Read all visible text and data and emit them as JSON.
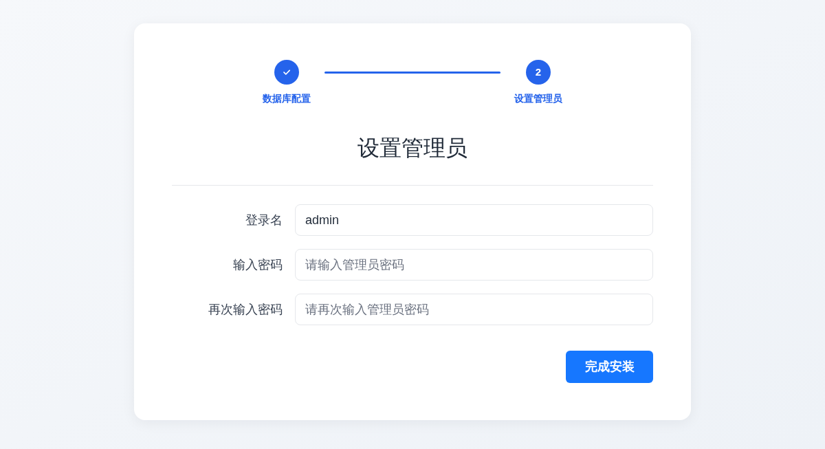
{
  "steps": [
    {
      "label": "数据库配置",
      "completed": true
    },
    {
      "number": "2",
      "label": "设置管理员",
      "completed": false
    }
  ],
  "title": "设置管理员",
  "fields": [
    {
      "label": "登录名",
      "value": "admin"
    },
    {
      "label": "输入密码",
      "placeholder": "请输入管理员密码"
    },
    {
      "label": "再次输入密码",
      "placeholder": "请再次输入管理员密码"
    }
  ],
  "submit_button": "完成安装"
}
